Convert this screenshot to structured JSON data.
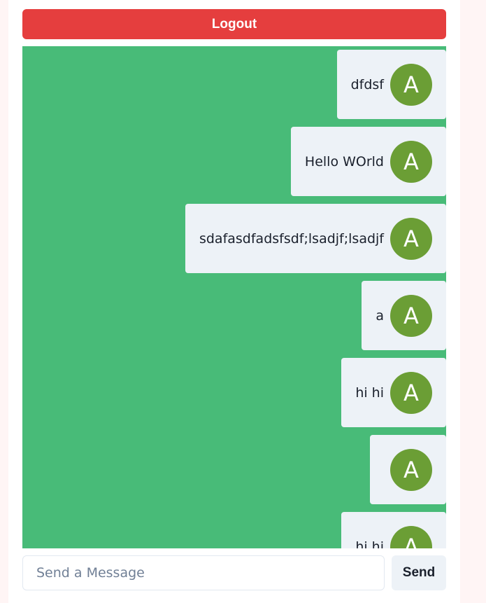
{
  "header": {
    "logout_label": "Logout"
  },
  "chat": {
    "messages": [
      {
        "text": "dfdsf",
        "avatar": "A"
      },
      {
        "text": "Hello WOrld",
        "avatar": "A"
      },
      {
        "text": "sdafasdfadsfsdf;lsadjf;lsadjf",
        "avatar": "A"
      },
      {
        "text": "a",
        "avatar": "A"
      },
      {
        "text": "hi hi",
        "avatar": "A"
      },
      {
        "text": "",
        "avatar": "A"
      },
      {
        "text": "hi hi",
        "avatar": "A"
      }
    ]
  },
  "composer": {
    "placeholder": "Send a Message",
    "value": "",
    "send_label": "Send"
  },
  "colors": {
    "logout_bg": "#e53e3e",
    "chat_bg": "#48bb78",
    "message_bg": "#edf2f7",
    "avatar_bg": "#6b9e35"
  }
}
